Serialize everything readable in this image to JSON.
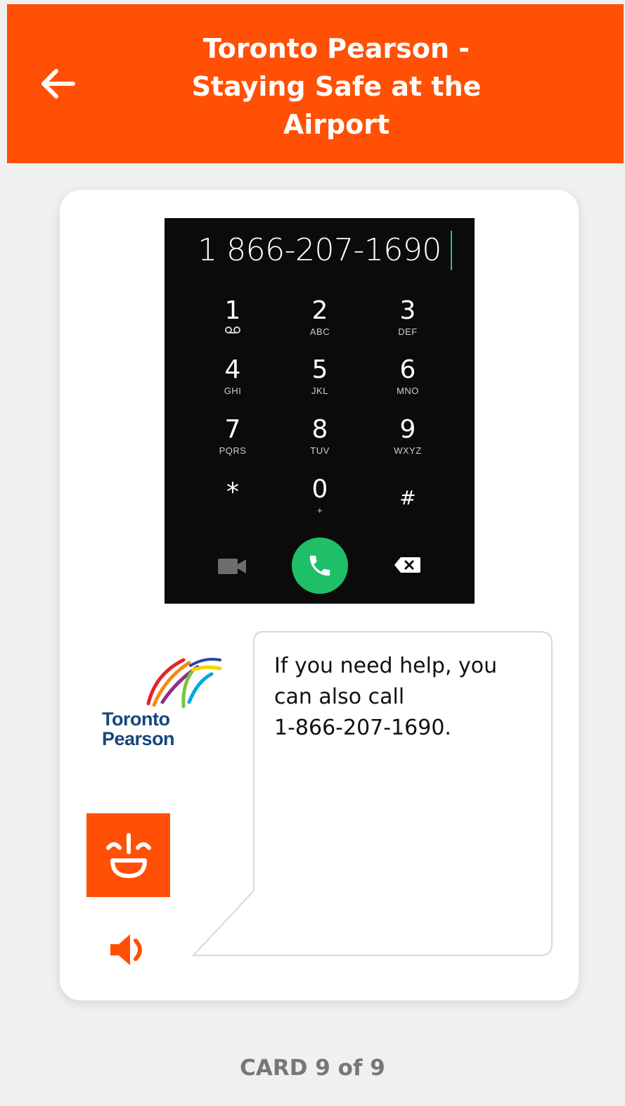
{
  "header": {
    "back_icon": "arrow-left-icon",
    "title_lines": [
      "Toronto Pearson -",
      "Staying Safe at the",
      "Airport"
    ],
    "background": "#ff5005"
  },
  "dialer": {
    "number": "1 866-207-1690",
    "keys": [
      {
        "digit": "1",
        "letters": "voicemail-icon"
      },
      {
        "digit": "2",
        "letters": "ABC"
      },
      {
        "digit": "3",
        "letters": "DEF"
      },
      {
        "digit": "4",
        "letters": "GHI"
      },
      {
        "digit": "5",
        "letters": "JKL"
      },
      {
        "digit": "6",
        "letters": "MNO"
      },
      {
        "digit": "7",
        "letters": "PQRS"
      },
      {
        "digit": "8",
        "letters": "TUV"
      },
      {
        "digit": "9",
        "letters": "WXYZ"
      },
      {
        "digit": "*",
        "letters": ""
      },
      {
        "digit": "0",
        "letters": "+"
      },
      {
        "digit": "#",
        "letters": ""
      }
    ],
    "icons": [
      "video-call-icon",
      "phone-call-icon",
      "backspace-icon"
    ],
    "call_color": "#1fbf68"
  },
  "logo": {
    "lines": [
      "Toronto",
      "Pearson"
    ]
  },
  "bubble": {
    "lines": [
      "If you need help, you",
      "can also call",
      "1-866-207-1690."
    ]
  },
  "controls": {
    "face_icon": "smiley-face-icon",
    "speaker_icon": "speaker-icon"
  },
  "footer": {
    "counter": "CARD 9 of 9"
  }
}
